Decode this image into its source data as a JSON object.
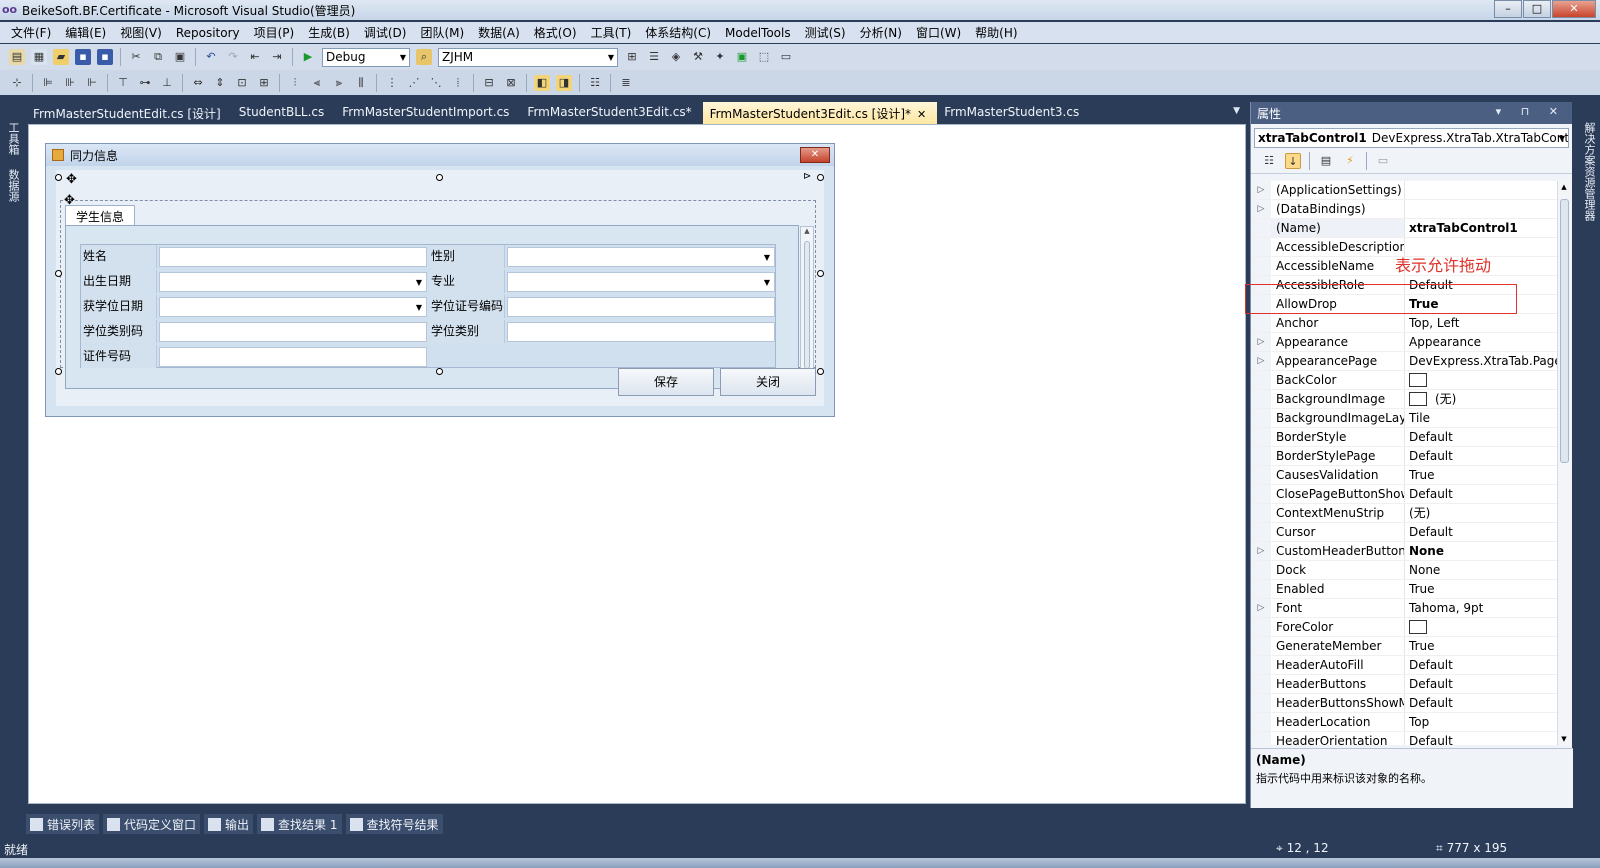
{
  "window": {
    "title": "BeikeSoft.BF.Certificate - Microsoft Visual Studio(管理员)",
    "logo": "oo"
  },
  "menu": [
    "文件(F)",
    "编辑(E)",
    "视图(V)",
    "Repository",
    "项目(P)",
    "生成(B)",
    "调试(D)",
    "团队(M)",
    "数据(A)",
    "格式(O)",
    "工具(T)",
    "体系结构(C)",
    "ModelTools",
    "测试(S)",
    "分析(N)",
    "窗口(W)",
    "帮助(H)"
  ],
  "toolbar": {
    "config": "Debug",
    "project": "ZJHM"
  },
  "left_strip": [
    "工具箱",
    "数据源"
  ],
  "right_strip": "解决方案资源管理器",
  "doc_tabs": [
    {
      "label": "FrmMasterStudentEdit.cs [设计]",
      "active": false
    },
    {
      "label": "StudentBLL.cs",
      "active": false
    },
    {
      "label": "FrmMasterStudentImport.cs",
      "active": false
    },
    {
      "label": "FrmMasterStudent3Edit.cs*",
      "active": false
    },
    {
      "label": "FrmMasterStudent3Edit.cs [设计]*",
      "active": true
    },
    {
      "label": "FrmMasterStudent3.cs",
      "active": false
    }
  ],
  "form": {
    "title": "同力信息",
    "tab_label": "学生信息",
    "fields": [
      {
        "label": "姓名"
      },
      {
        "label": "性别"
      },
      {
        "label": "出生日期"
      },
      {
        "label": "专业"
      },
      {
        "label": "获学位日期"
      },
      {
        "label": "学位证号编码"
      },
      {
        "label": "学位类别码"
      },
      {
        "label": "学位类别"
      },
      {
        "label": "证件号码"
      }
    ],
    "save_label": "保存",
    "close_label": "关闭"
  },
  "properties": {
    "title": "属性",
    "object_name": "xtraTabControl1",
    "object_type": "DevExpress.XtraTab.XtraTabContr",
    "annotation": "表示允许拖动",
    "rows": [
      {
        "name": "(ApplicationSettings)",
        "value": "",
        "expand": true
      },
      {
        "name": "(DataBindings)",
        "value": "",
        "expand": true
      },
      {
        "name": "(Name)",
        "value": "xtraTabControl1",
        "bold": true
      },
      {
        "name": "AccessibleDescription",
        "value": ""
      },
      {
        "name": "AccessibleName",
        "value": ""
      },
      {
        "name": "AccessibleRole",
        "value": "Default"
      },
      {
        "name": "AllowDrop",
        "value": "True",
        "bold": true
      },
      {
        "name": "Anchor",
        "value": "Top, Left"
      },
      {
        "name": "Appearance",
        "value": "Appearance",
        "expand": true
      },
      {
        "name": "AppearancePage",
        "value": "DevExpress.XtraTab.Page",
        "expand": true
      },
      {
        "name": "BackColor",
        "value": "",
        "swatch": true
      },
      {
        "name": "BackgroundImage",
        "value": "(无)",
        "swatch": true
      },
      {
        "name": "BackgroundImageLay",
        "value": "Tile"
      },
      {
        "name": "BorderStyle",
        "value": "Default"
      },
      {
        "name": "BorderStylePage",
        "value": "Default"
      },
      {
        "name": "CausesValidation",
        "value": "True"
      },
      {
        "name": "ClosePageButtonShow",
        "value": "Default"
      },
      {
        "name": "ContextMenuStrip",
        "value": "(无)"
      },
      {
        "name": "Cursor",
        "value": "Default"
      },
      {
        "name": "CustomHeaderButtons",
        "value": "None",
        "bold": true,
        "expand": true
      },
      {
        "name": "Dock",
        "value": "None"
      },
      {
        "name": "Enabled",
        "value": "True"
      },
      {
        "name": "Font",
        "value": "Tahoma, 9pt",
        "expand": true
      },
      {
        "name": "ForeColor",
        "value": "",
        "swatch": true
      },
      {
        "name": "GenerateMember",
        "value": "True"
      },
      {
        "name": "HeaderAutoFill",
        "value": "Default"
      },
      {
        "name": "HeaderButtons",
        "value": "Default"
      },
      {
        "name": "HeaderButtonsShowM",
        "value": "Default"
      },
      {
        "name": "HeaderLocation",
        "value": "Top"
      },
      {
        "name": "HeaderOrientation",
        "value": "Default"
      }
    ],
    "desc_title": "(Name)",
    "desc_text": "指示代码中用来标识该对象的名称。"
  },
  "bottom_tabs": [
    "错误列表",
    "代码定义窗口",
    "输出",
    "查找结果 1",
    "查找符号结果"
  ],
  "status": {
    "ready": "就绪",
    "position": "12 , 12",
    "size": "777 x 195"
  }
}
